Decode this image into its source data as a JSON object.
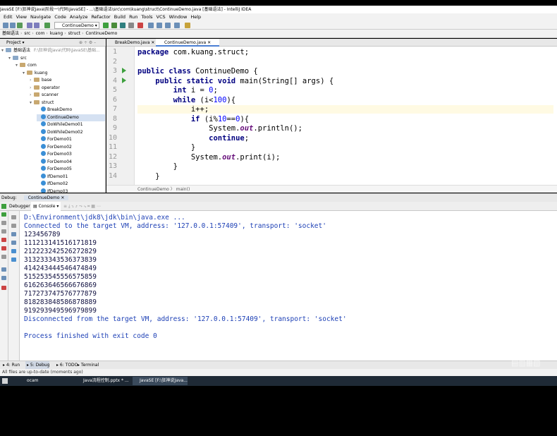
{
  "window": {
    "title": "JavaSE [F:\\狂神说Java\\阶段一\\代码\\JavaSE] - ...\\基础语法\\src\\com\\kuang\\struct\\ContinueDemo.java [基础语法] - IntelliJ IDEA"
  },
  "menu": [
    "Edit",
    "View",
    "Navigate",
    "Code",
    "Analyze",
    "Refactor",
    "Build",
    "Run",
    "Tools",
    "VCS",
    "Window",
    "Help"
  ],
  "toolbar": {
    "run_config": "ContinueDemo"
  },
  "nav": [
    "基础语法",
    "src",
    "com",
    "kuang",
    "struct",
    "ContinueDemo"
  ],
  "project": {
    "header": "Project",
    "root": "基础语法",
    "root_path": "F:\\狂神说Java\\代码\\JavaSE\\基础...",
    "tree": [
      {
        "label": "src",
        "depth": 1,
        "kind": "folder",
        "arrow": "▾"
      },
      {
        "label": "com",
        "depth": 2,
        "kind": "pkg",
        "arrow": "▾"
      },
      {
        "label": "kuang",
        "depth": 3,
        "kind": "pkg",
        "arrow": "▾"
      },
      {
        "label": "base",
        "depth": 4,
        "kind": "pkg",
        "arrow": "›"
      },
      {
        "label": "operator",
        "depth": 4,
        "kind": "pkg",
        "arrow": "›"
      },
      {
        "label": "scanner",
        "depth": 4,
        "kind": "pkg",
        "arrow": "›"
      },
      {
        "label": "struct",
        "depth": 4,
        "kind": "pkg",
        "arrow": "▾"
      },
      {
        "label": "BreakDemo",
        "depth": 5,
        "kind": "class"
      },
      {
        "label": "ContinueDemo",
        "depth": 5,
        "kind": "class",
        "selected": true
      },
      {
        "label": "DoWhileDemo01",
        "depth": 5,
        "kind": "class"
      },
      {
        "label": "DoWhileDemo02",
        "depth": 5,
        "kind": "class"
      },
      {
        "label": "ForDemo01",
        "depth": 5,
        "kind": "class"
      },
      {
        "label": "ForDemo02",
        "depth": 5,
        "kind": "class"
      },
      {
        "label": "ForDemo03",
        "depth": 5,
        "kind": "class"
      },
      {
        "label": "ForDemo04",
        "depth": 5,
        "kind": "class"
      },
      {
        "label": "ForDemo05",
        "depth": 5,
        "kind": "class"
      },
      {
        "label": "IfDemo01",
        "depth": 5,
        "kind": "class"
      },
      {
        "label": "IfDemo02",
        "depth": 5,
        "kind": "class"
      },
      {
        "label": "IfDemo03",
        "depth": 5,
        "kind": "class"
      }
    ]
  },
  "editor": {
    "tabs": [
      {
        "label": "BreakDemo.java",
        "active": false
      },
      {
        "label": "ContinueDemo.java",
        "active": true
      }
    ],
    "lines": [
      {
        "n": "1",
        "html": "<span class=\"kw\">package</span> com.kuang.struct;"
      },
      {
        "n": "2",
        "html": ""
      },
      {
        "n": "3",
        "html": "<span class=\"kw\">public class</span> ContinueDemo {"
      },
      {
        "n": "4",
        "html": "    <span class=\"kw\">public static void</span> main(String[] args) {"
      },
      {
        "n": "5",
        "html": "        <span class=\"kw\">int</span> i = <span class=\"num\">0</span>;"
      },
      {
        "n": "6",
        "html": "        <span class=\"kw\">while</span> (i&lt;<span class=\"num\">100</span>){"
      },
      {
        "n": "7",
        "html": "            i++;",
        "current": true
      },
      {
        "n": "8",
        "html": "            <span class=\"kw\">if</span> (i%<span class=\"num\">10</span>==<span class=\"num\">0</span>){"
      },
      {
        "n": "9",
        "html": "                System.<span class=\"it\">out</span>.println();"
      },
      {
        "n": "10",
        "html": "                <span class=\"kw\">continue</span>;"
      },
      {
        "n": "11",
        "html": "            }"
      },
      {
        "n": "12",
        "html": "            System.<span class=\"it\">out</span>.print(i);"
      },
      {
        "n": "13",
        "html": "        }"
      },
      {
        "n": "14",
        "html": "    }"
      }
    ],
    "breadcrumb": "ContinueDemo  〉 main()"
  },
  "debug": {
    "label": "Debug:",
    "config": "ContinueDemo",
    "tab_debugger": "Debugger",
    "tab_console": "Console"
  },
  "console": [
    {
      "text": "D:\\Environment\\jdk8\\jdk\\bin\\java.exe ...",
      "cls": "blue"
    },
    {
      "text": "Connected to the target VM, address: '127.0.0.1:57409', transport: 'socket'",
      "cls": "blue"
    },
    {
      "text": "123456789",
      "cls": "dark"
    },
    {
      "text": "111213141516171819",
      "cls": "dark"
    },
    {
      "text": "212223242526272829",
      "cls": "dark"
    },
    {
      "text": "313233343536373839",
      "cls": "dark"
    },
    {
      "text": "414243444546474849",
      "cls": "dark"
    },
    {
      "text": "515253545556575859",
      "cls": "dark"
    },
    {
      "text": "616263646566676869",
      "cls": "dark"
    },
    {
      "text": "717273747576777879",
      "cls": "dark"
    },
    {
      "text": "818283848586878889",
      "cls": "dark"
    },
    {
      "text": "919293949596979899",
      "cls": "dark"
    },
    {
      "text": "Disconnected from the target VM, address: '127.0.0.1:57409', transport: 'socket'",
      "cls": "blue"
    },
    {
      "text": "",
      "cls": "dark"
    },
    {
      "text": "Process finished with exit code 0",
      "cls": "blue"
    }
  ],
  "bottom_tabs": [
    "4: Run",
    "5: Debug",
    "6: TODO",
    "Terminal"
  ],
  "status": "All files are up-to-date (moments ago)",
  "taskbar": {
    "items": [
      "ocam",
      "Java流程控制.pptx * ...",
      "JavaSE [F:\\狂神说Java..."
    ]
  }
}
